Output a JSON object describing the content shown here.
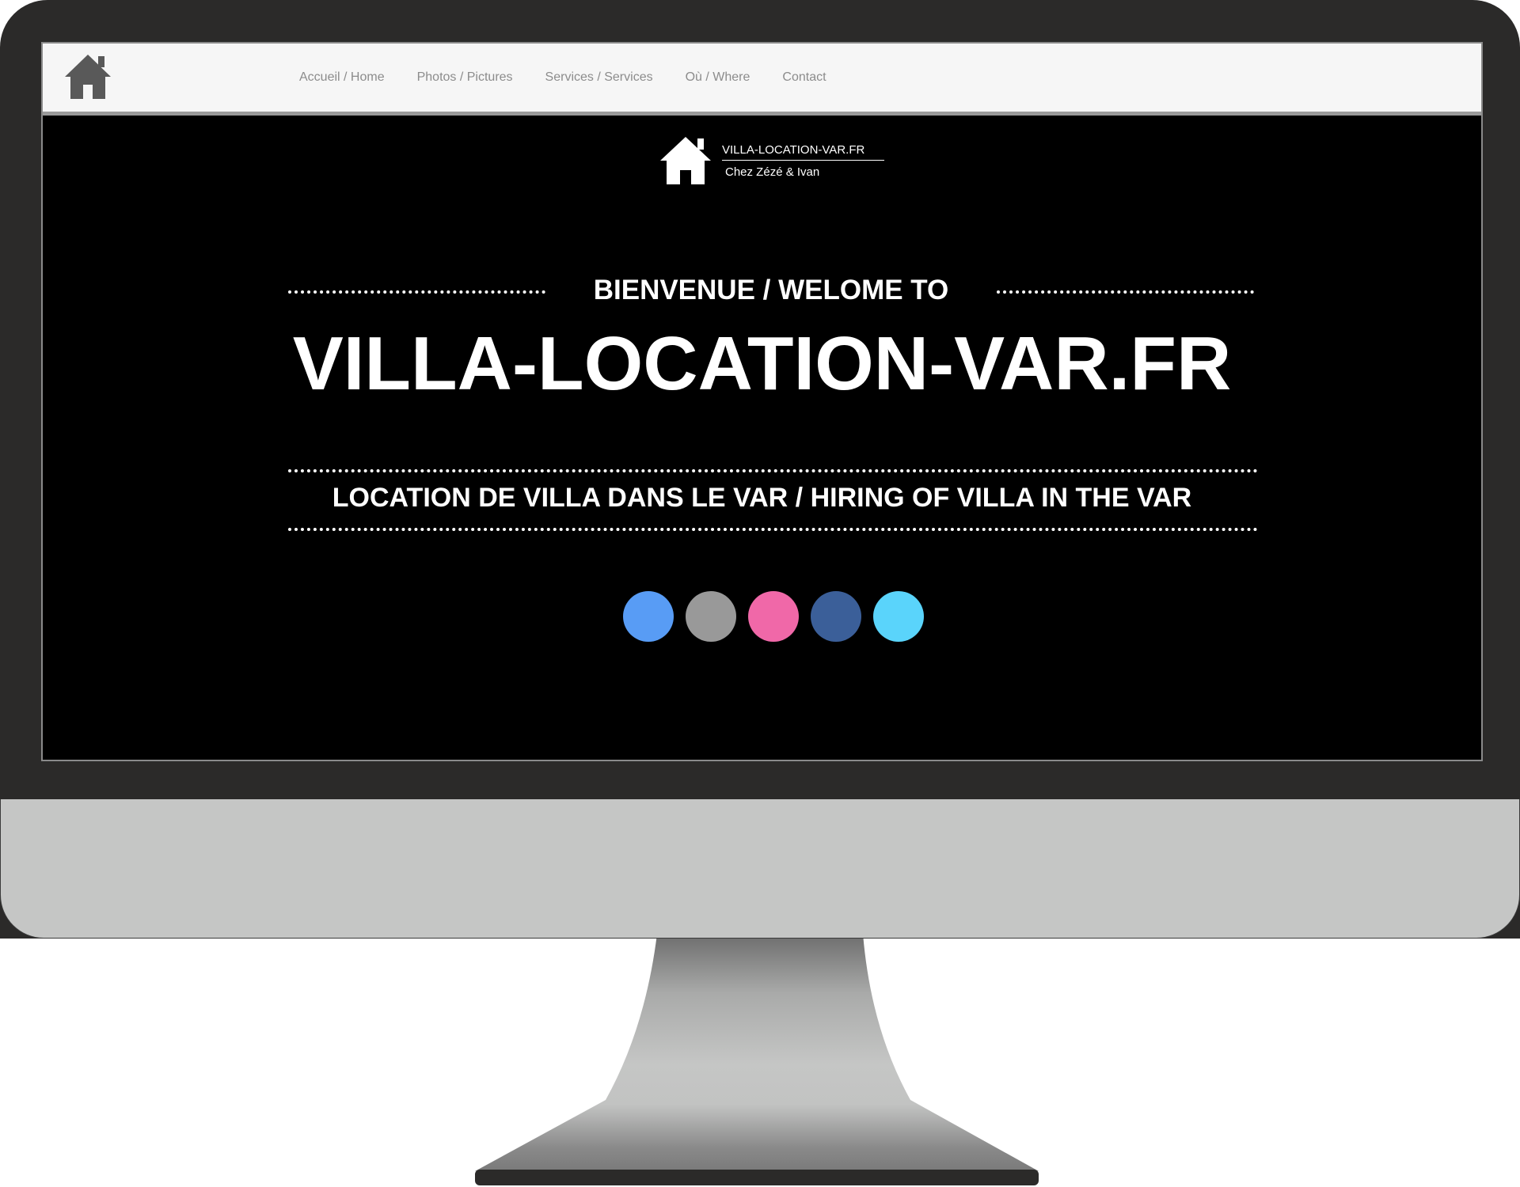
{
  "nav": {
    "items": [
      {
        "label": "Accueil / Home"
      },
      {
        "label": "Photos / Pictures"
      },
      {
        "label": "Services / Services"
      },
      {
        "label": "Où / Where"
      },
      {
        "label": "Contact"
      }
    ]
  },
  "logo": {
    "title": "VILLA-LOCATION-VAR.FR",
    "subtitle": "Chez Zézé & Ivan"
  },
  "hero": {
    "welcome": "BIENVENUE / WELOME TO",
    "title": "VILLA-LOCATION-VAR.FR",
    "tagline": "LOCATION DE VILLA DANS LE VAR / HIRING OF VILLA IN THE VAR"
  },
  "social": {
    "colors": [
      "#589cf5",
      "#999999",
      "#f068a8",
      "#3b5f99",
      "#5ad4fb"
    ]
  },
  "colors": {
    "bezel": "#2b2a29",
    "chin": "#c5c6c5",
    "screen_bg": "#000000",
    "navbar_bg": "#f6f6f6",
    "nav_text": "#8c8c8c",
    "hero_text": "#ffffff"
  }
}
